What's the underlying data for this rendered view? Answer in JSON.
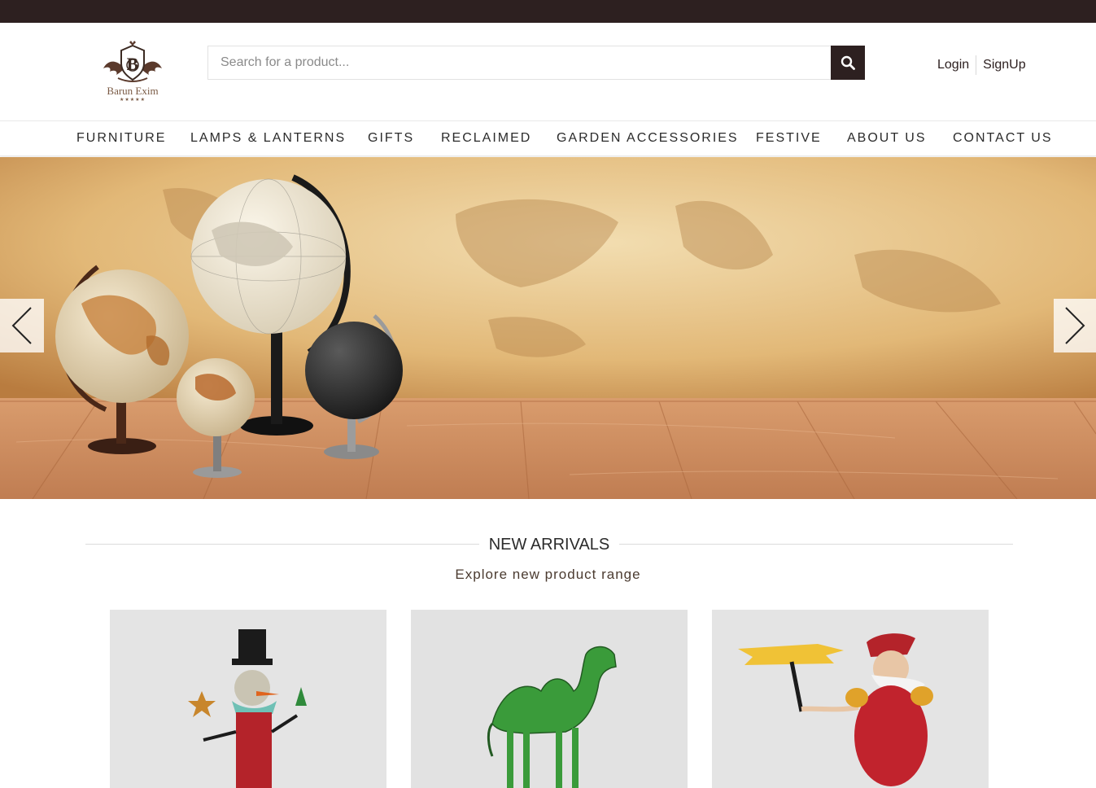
{
  "brand": {
    "name": "Barun Exim",
    "stars": "★★★★★",
    "accent_color": "#2d2020",
    "text_brown": "#7a5a44"
  },
  "search": {
    "placeholder": "Search for a product...",
    "value": "",
    "icon": "search-icon"
  },
  "auth": {
    "login_label": "Login",
    "signup_label": "SignUp"
  },
  "nav": {
    "items": [
      {
        "label": "FURNITURE"
      },
      {
        "label": "LAMPS & LANTERNS"
      },
      {
        "label": "GIFTS"
      },
      {
        "label": "RECLAIMED"
      },
      {
        "label": "GARDEN ACCESSORIES"
      },
      {
        "label": "FESTIVE"
      },
      {
        "label": "ABOUT US"
      },
      {
        "label": "CONTACT US"
      }
    ]
  },
  "hero": {
    "prev_icon": "chevron-left-icon",
    "next_icon": "chevron-right-icon"
  },
  "new_arrivals": {
    "title": "NEW ARRIVALS",
    "subtitle": "Explore new product range",
    "products": [
      {
        "image": "snowman-figurine"
      },
      {
        "image": "green-camel-figurine"
      },
      {
        "image": "santa-with-sign-figurine"
      }
    ]
  }
}
